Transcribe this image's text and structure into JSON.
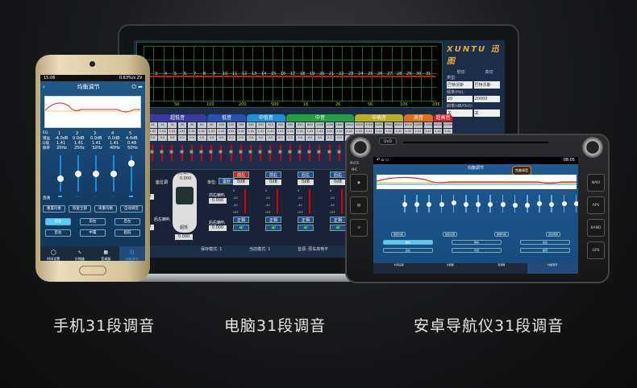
{
  "captions": {
    "phone": "手机31段调音",
    "pc": "电脑31段调音",
    "android": "安卓导航仪31段调音"
  },
  "laptop": {
    "band_numbers": [
      "2",
      "3",
      "4",
      "5",
      "6",
      "7",
      "8",
      "9",
      "10",
      "11",
      "12",
      "13",
      "14",
      "15",
      "16",
      "17",
      "18",
      "19",
      "20",
      "21",
      "22",
      "23",
      "24",
      "25",
      "26",
      "27",
      "28",
      "29",
      "30",
      "31"
    ],
    "x_ticks": [
      "20",
      "50",
      "100",
      "200",
      "500",
      "1K",
      "2K",
      "5K",
      "10K",
      "20K"
    ],
    "right_panel": {
      "logo": "XUNTU 迅图",
      "low_cut": "低切",
      "high_cut": "高切",
      "type_label": "类型:",
      "type_value": "巴特沃斯",
      "freq_label": "频率(Hz):",
      "low_freq": "20",
      "high_freq": "20000",
      "slope_label": "斜率(dB/Oct):",
      "slope_value": "关"
    },
    "band_tabs": [
      {
        "label": "超低音",
        "color": "#3a3aa0"
      },
      {
        "label": "低音",
        "color": "#2850b0"
      },
      {
        "label": "中低音",
        "color": "#1e90d8"
      },
      {
        "label": "中音",
        "color": "#20a040"
      },
      {
        "label": "中高音",
        "color": "#b8b020"
      },
      {
        "label": "高音",
        "color": "#e07010"
      },
      {
        "label": "超高音",
        "color": "#d02020"
      }
    ],
    "freqs": [
      "20",
      "25",
      "32",
      "40",
      "50",
      "63",
      "80",
      "100",
      "125",
      "160",
      "200",
      "250",
      "315",
      "400",
      "500",
      "630",
      "800",
      "1000",
      "1250",
      "1600",
      "2000",
      "2500",
      "3150",
      "4000",
      "5000",
      "6300",
      "8000",
      "10000",
      "12500",
      "16000",
      "20000"
    ],
    "q_value": "1.41",
    "gain_value": "0.0",
    "position_labels": {
      "seat": "座位调",
      "front_left": "前左喇叭",
      "front_right": "前右喇叭",
      "rear_left": "后左喇叭",
      "rear_right": "后右喇叭",
      "sub": "超低",
      "unit_label": "单位:",
      "unit_value": "毫秒",
      "delay": "0.000"
    },
    "channels": [
      {
        "label": "前左",
        "active": true
      },
      {
        "label": "前右",
        "active": false
      },
      {
        "label": "后左",
        "active": false
      },
      {
        "label": "后右",
        "active": false
      }
    ],
    "channel_level": "0dB",
    "mute_label": "正相",
    "scale": [
      "0",
      "-20",
      "-40",
      "OFF"
    ],
    "status": {
      "save_mode": "保存模式: 1",
      "current_mode": "当前模式: 1",
      "source": "音源: 原车高电平"
    }
  },
  "phone": {
    "status_time": "15:06",
    "status_right": "0.63%/s  29",
    "title": "均衡调节",
    "row_labels": [
      "EQ",
      "增益",
      "Q值",
      "频率",
      "直通"
    ],
    "bands": [
      {
        "n": "1",
        "gain": "-4.0dB",
        "q": "1.41",
        "f": "20Hz",
        "level": 0.35,
        "on": true
      },
      {
        "n": "2",
        "gain": "0.0dB",
        "q": "1.41",
        "f": "25Hz",
        "level": 0.5,
        "on": false
      },
      {
        "n": "3",
        "gain": "0.0dB",
        "q": "1.41",
        "f": "32Hz",
        "level": 0.5,
        "on": false
      },
      {
        "n": "4",
        "gain": "0.0dB",
        "q": "1.41",
        "f": "40Hz",
        "level": 0.5,
        "on": false
      },
      {
        "n": "5",
        "gain": "4.4dB",
        "q": "0.48",
        "f": "50Hz",
        "level": 0.78,
        "on": true
      }
    ],
    "buttons": [
      "重置均衡",
      "恢复全部",
      "串重均衡",
      "自动调音"
    ],
    "channels": [
      "前左",
      "前右",
      "后左",
      "后右",
      "中置",
      "超低"
    ],
    "tabs": [
      "时间设置",
      "分频器",
      "音调器",
      "均衡调节"
    ]
  },
  "car": {
    "time": "08:05",
    "title": "均衡调节",
    "badge": "完美调音",
    "side_left": [
      "MUTE",
      "MIC"
    ],
    "side_right": [
      "NAVI",
      "APS",
      "BAND",
      "GPS"
    ],
    "dvd": "DVD",
    "levels": [
      0.45,
      0.45,
      0.45,
      0.45,
      0.55,
      0.45,
      0.45,
      0.45,
      0.45,
      0.4,
      0.4,
      0.5,
      0.45,
      0.5,
      0.5
    ],
    "buttons": [
      "重置均衡",
      "恢复全部",
      "串重均衡",
      "自动调音"
    ],
    "channels": [
      "前左",
      "前右",
      "后左",
      "后右",
      "中置",
      "超低"
    ],
    "tabs": [
      "时间设置",
      "分频器",
      "音调器",
      "均衡调节"
    ]
  }
}
